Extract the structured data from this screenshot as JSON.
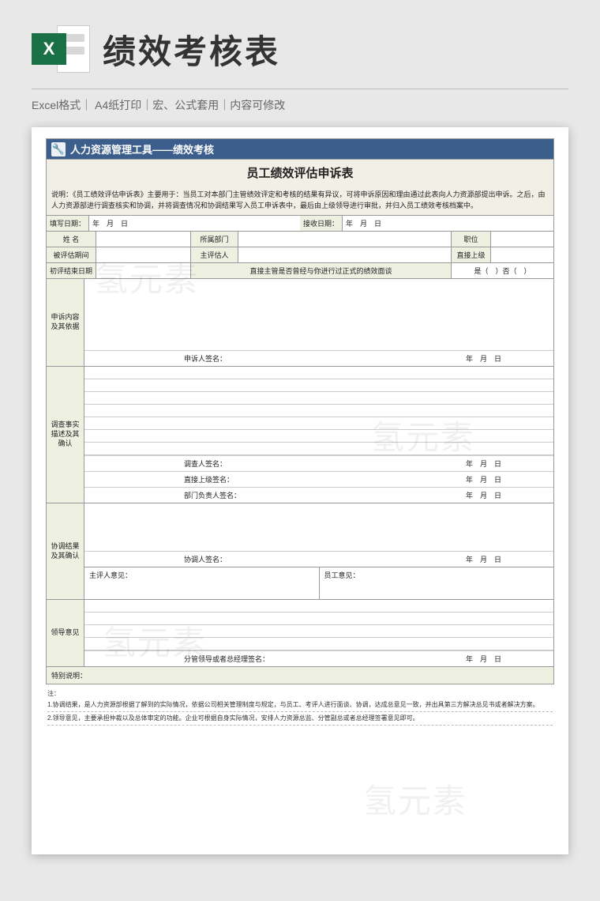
{
  "header": {
    "icon_letter": "X",
    "title": "绩效考核表",
    "meta": "Excel格式｜ A4纸打印｜宏、公式套用｜内容可修改"
  },
  "watermark": "氢元素",
  "doc": {
    "banner": "人力资源管理工具——绩效考核",
    "form_title": "员工绩效评估申诉表",
    "description": "说明：《员工绩效评估申诉表》主要用于：当员工对本部门主管绩效评定和考核的结果有异议，可将申诉原因和理由通过此表向人力资源部提出申诉。之后，由人力资源部进行调查核实和协调，并将调查情况和协调结果写入员工申诉表中，最后由上级领导进行审批，并归入员工绩效考核档案中。",
    "dates": {
      "fill_label": "填写日期：",
      "fill_value": "年　月　日",
      "recv_label": "接收日期：",
      "recv_value": "年　月　日"
    },
    "info": {
      "name": "姓 名",
      "dept": "所属部门",
      "position": "职位",
      "period": "被评估期间",
      "assessor": "主评估人",
      "superior": "直接上级",
      "enddate": "初评结束日期",
      "interview_q": "直接主管是否曾经与你进行过正式的绩效面谈",
      "interview_opt": "是（　）否（　）"
    },
    "sections": {
      "s1": "申诉内容及其依据",
      "s1_sig": "申诉人签名：",
      "s2": "调查事实描述及其确认",
      "s2_sig1": "调查人签名：",
      "s2_sig2": "直接上级签名：",
      "s2_sig3": "部门负责人签名：",
      "s3": "协调结果及其确认",
      "s3_sig": "协调人签名：",
      "s3_left": "主评人意见：",
      "s3_right": "员工意见：",
      "s4": "领导意见",
      "s4_sig": "分管领导或者总经理签名：",
      "date_fmt": "年　月　日"
    },
    "special_label": "特别说明：",
    "notes": {
      "head": "注：",
      "n1": "1.协调结果，是人力资源部根据了解到的实际情况，依据公司相关管理制度与规定，与员工、考评人进行面谈、协调，达成总意见一致，并出具第三方解决总见书或者解决方案。",
      "n2": "2.领导意见，主要承担仲裁以及总体审定的功能。企业可根据自身实际情况，安排人力资源总监、分管副总或者总经理签署意见即可。"
    }
  }
}
